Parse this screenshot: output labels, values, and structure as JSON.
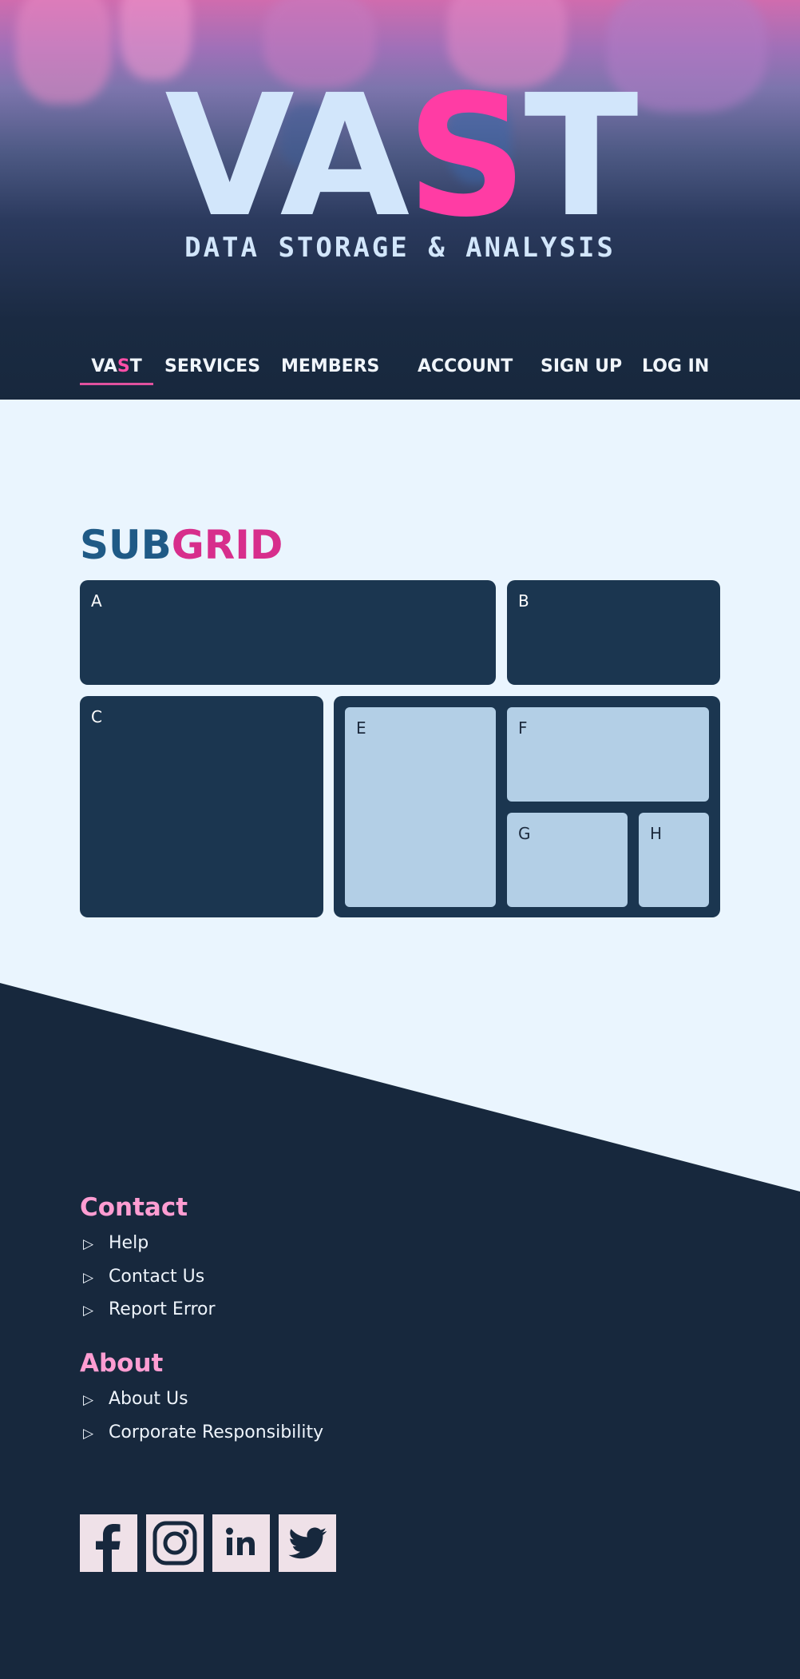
{
  "header": {
    "logo_prefix": "VA",
    "logo_accent": "S",
    "logo_suffix": "T",
    "tagline": "DATA STORAGE & ANALYSIS"
  },
  "nav": {
    "home_prefix": "VA",
    "home_accent": "S",
    "home_suffix": "T",
    "items": [
      "SERVICES",
      "MEMBERS",
      "ACCOUNT",
      "SIGN UP",
      "LOG IN"
    ]
  },
  "main": {
    "title_part1": "SUB",
    "title_part2": "GRID",
    "cells": {
      "a": "A",
      "b": "B",
      "c": "C",
      "e": "E",
      "f": "F",
      "g": "G",
      "h": "H"
    }
  },
  "footer": {
    "contact_heading": "Contact",
    "contact_links": [
      "Help",
      "Contact Us",
      "Report Error"
    ],
    "about_heading": "About",
    "about_links": [
      "About Us",
      "Corporate Responsibility"
    ],
    "bullet_icon": "play-triangle-outline-icon",
    "social": [
      "facebook-icon",
      "instagram-icon",
      "linkedin-icon",
      "twitter-icon"
    ]
  },
  "colors": {
    "accent_pink": "#ff3ca4",
    "dark_navy": "#17283d",
    "panel_navy": "#1b3650",
    "light_panel": "#b3cfe6",
    "page_bg": "#eaf5fe",
    "footer_heading": "#ff9dd2"
  }
}
